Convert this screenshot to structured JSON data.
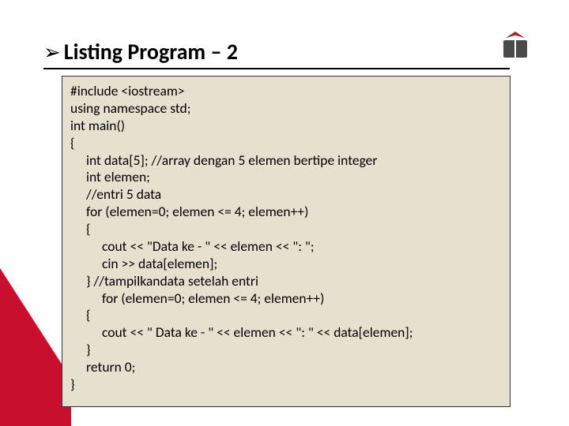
{
  "header": {
    "arrow": "➢",
    "title": "Listing Program – 2"
  },
  "code": {
    "l1": "#include <iostream>",
    "l2": "using namespace std;",
    "l3": "int main()",
    "l4": "{",
    "l5": "int data[5]; //array dengan 5 elemen bertipe integer",
    "l6": "int elemen;",
    "l7": "//entri 5 data",
    "l8": "for (elemen=0; elemen <= 4; elemen++)",
    "l9": "{",
    "l10": "cout << \"Data ke - \" << elemen << \": \";",
    "l11": "cin >> data[elemen];",
    "l12": "} //tampilkandata setelah entri",
    "l13": "for (elemen=0; elemen <= 4; elemen++)",
    "l14": "{",
    "l15": "cout << \" Data ke - \" << elemen << \": \" << data[elemen];",
    "l16": "}",
    "l17": "return 0;",
    "l18": "}"
  }
}
